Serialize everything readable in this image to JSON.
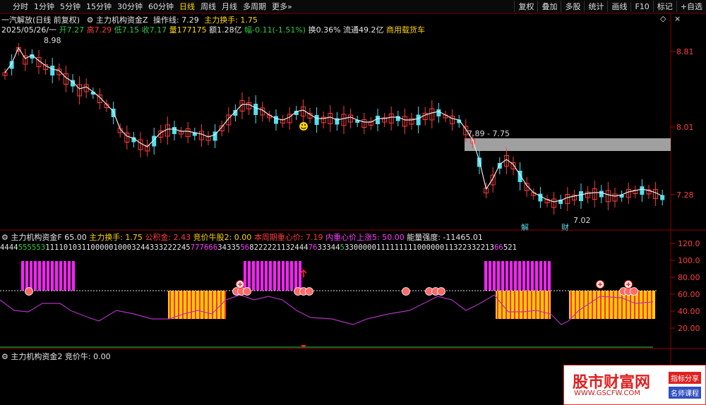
{
  "toolbar": {
    "periods": [
      "分时",
      "1分钟",
      "5分钟",
      "15分钟",
      "30分钟",
      "60分钟",
      "日线",
      "周线",
      "月线",
      "多周期",
      "更多"
    ],
    "active_period": "日线",
    "tools": [
      "复权",
      "叠加",
      "多股",
      "统计",
      "画线",
      "F10",
      "标记",
      "+自选"
    ]
  },
  "main_chart": {
    "stock": "一汽解放(日线 前复权)",
    "indicator": "主力机构资金Z",
    "op_label": "操作线: 7.29",
    "turnover_label": "主力换手: 1.75",
    "ohlc": {
      "date": "2025/05/26/一",
      "open": "开7.27",
      "high": "高7.29",
      "low": "低7.15",
      "close": "收7.17",
      "volume": "量177175",
      "amount": "额1.28亿",
      "change": "幅-0.11(-1.51%)",
      "turnover": "换0.36%",
      "float": "流通49.2亿",
      "sector": "商用载货车"
    },
    "price_axis": [
      "8.81",
      "8.01",
      "7.28"
    ],
    "annotations": {
      "high": "8.98",
      "zone": "7.89 - 7.75",
      "low": "7.02",
      "mark1": "解",
      "mark2": "财"
    }
  },
  "panel2": {
    "name": "主力机构资金F",
    "value": "65.00",
    "turnover": "主力换手: 1.75",
    "fair": "公积金: 2.43",
    "bull": "竞价牛股2: 0.00",
    "cycle": "本周期重心价: 7.19",
    "up": "内重心价上涨5: 50.00",
    "strength": "能量强度: -11465.01",
    "axis": [
      "120.0",
      "100.0",
      "80.00",
      "60.00",
      "40.00",
      "20.00"
    ],
    "sequence_green": "555553",
    "sequence_rest": "4444",
    "sequence_tail": "11110103110000010003244333222245",
    "sequence_mag": "777666",
    "sequence_mid": "34335",
    "sequence_mag2": "56",
    "sequence_b": "8222221132444",
    "sequence_mag3": "76",
    "sequence_c": "33344",
    "sequence_g2": "5",
    "sequence_d": "33000001111111110000001132233221",
    "sequence_e": "3",
    "sequence_mag4": "66",
    "sequence_f": "521"
  },
  "panel3": {
    "name": "主力机构资金2",
    "value": "竞价牛: 0.00"
  },
  "logo": {
    "main": "股市财富网",
    "url": "WWW.GSCFW.COM",
    "tag1": "指标分享",
    "tag2": "名师课程"
  }
}
